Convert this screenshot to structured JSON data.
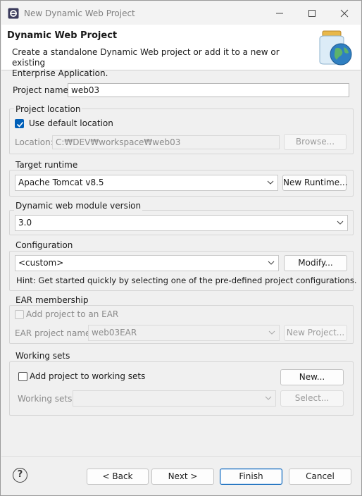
{
  "window": {
    "title": "New Dynamic Web Project"
  },
  "banner": {
    "title": "Dynamic Web Project",
    "description_line1": "Create a standalone Dynamic Web project or add it to a new or existing",
    "description_line2": "Enterprise Application."
  },
  "project_name": {
    "label": "Project name:",
    "value": "web03"
  },
  "project_location": {
    "group_label": "Project location",
    "use_default_label": "Use default location",
    "use_default_checked": true,
    "location_label": "Location:",
    "location_value": "C:₩DEV₩workspace₩web03",
    "browse_label": "Browse..."
  },
  "target_runtime": {
    "group_label": "Target runtime",
    "selected": "Apache Tomcat v8.5",
    "new_runtime_label": "New Runtime..."
  },
  "module_version": {
    "group_label": "Dynamic web module version",
    "selected": "3.0"
  },
  "configuration": {
    "group_label": "Configuration",
    "selected": "<custom>",
    "modify_label": "Modify...",
    "hint": "Hint: Get started quickly by selecting one of the pre-defined project configurations."
  },
  "ear_membership": {
    "group_label": "EAR membership",
    "add_label": "Add project to an EAR",
    "add_checked": false,
    "ear_name_label": "EAR project name:",
    "ear_name_value": "web03EAR",
    "new_project_label": "New Project..."
  },
  "working_sets": {
    "group_label": "Working sets",
    "add_label": "Add project to working sets",
    "add_checked": false,
    "new_label": "New...",
    "sets_label": "Working sets:",
    "sets_value": "",
    "select_label": "Select..."
  },
  "footer": {
    "help_glyph": "?",
    "back_label": "< Back",
    "next_label": "Next >",
    "finish_label": "Finish",
    "cancel_label": "Cancel"
  },
  "colors": {
    "accent": "#005fb8",
    "disabled_text": "#8a8a8a",
    "background": "#f0f0f0"
  }
}
